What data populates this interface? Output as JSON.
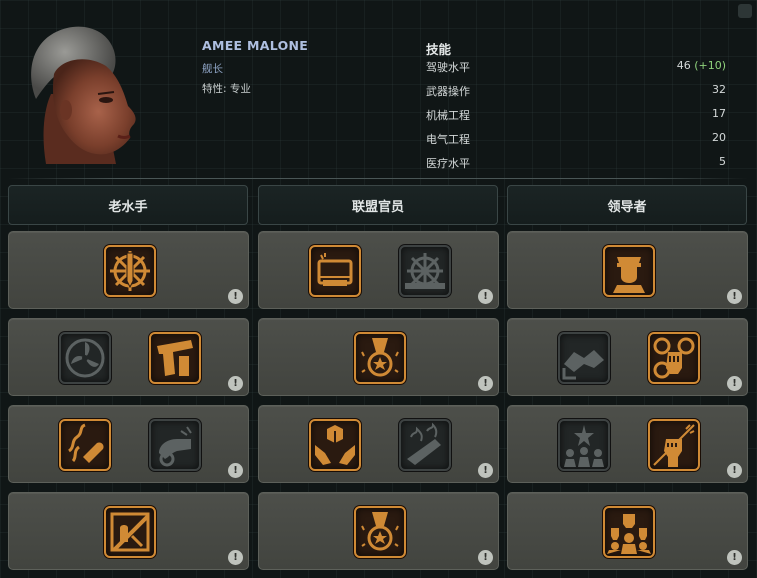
{
  "character": {
    "name": "AMEE MALONE",
    "rank": "舰长",
    "traits": "特性: 专业"
  },
  "skills": {
    "title": "技能",
    "items": [
      {
        "name": "驾驶水平",
        "value": "46",
        "bonus": "(+10)"
      },
      {
        "name": "武器操作",
        "value": "32",
        "bonus": ""
      },
      {
        "name": "机械工程",
        "value": "17",
        "bonus": ""
      },
      {
        "name": "电气工程",
        "value": "20",
        "bonus": ""
      },
      {
        "name": "医疗水平",
        "value": "5",
        "bonus": ""
      }
    ]
  },
  "columns": [
    {
      "label": "老水手"
    },
    {
      "label": "联盟官员"
    },
    {
      "label": "领导者"
    }
  ],
  "info_glyph": "!",
  "colors": {
    "accent_orange": "#d08a35",
    "panel": "#4d4f4a",
    "skill_bonus": "#8fd27c",
    "name": "#aebfe0"
  },
  "talent_grid": [
    [
      [
        {
          "icon": "ship-wheel-pencil-icon",
          "unlocked": true
        }
      ],
      [
        {
          "icon": "wire-crate-icon",
          "unlocked": true
        },
        {
          "icon": "ship-wheel-icon",
          "unlocked": false
        }
      ],
      [
        {
          "icon": "officer-portrait-icon",
          "unlocked": true
        }
      ]
    ],
    [
      [
        {
          "icon": "propeller-icon",
          "unlocked": false
        },
        {
          "icon": "pistol-icon",
          "unlocked": true
        }
      ],
      [
        {
          "icon": "star-medal-icon",
          "unlocked": true
        }
      ],
      [
        {
          "icon": "handshake-icon",
          "unlocked": false
        },
        {
          "icon": "fist-gear-icon",
          "unlocked": true
        }
      ]
    ],
    [
      [
        {
          "icon": "smoke-bullet-icon",
          "unlocked": true
        },
        {
          "icon": "cannon-icon",
          "unlocked": false
        }
      ],
      [
        {
          "icon": "hands-box-icon",
          "unlocked": true
        },
        {
          "icon": "burning-artillery-icon",
          "unlocked": false
        }
      ],
      [
        {
          "icon": "star-crowd-icon",
          "unlocked": false
        },
        {
          "icon": "raised-fist-icon",
          "unlocked": true
        }
      ]
    ],
    [
      [
        {
          "icon": "banned-sign-icon",
          "unlocked": true
        }
      ],
      [
        {
          "icon": "star-medal-icon",
          "unlocked": true
        }
      ],
      [
        {
          "icon": "crowd-fists-icon",
          "unlocked": true
        }
      ]
    ]
  ]
}
